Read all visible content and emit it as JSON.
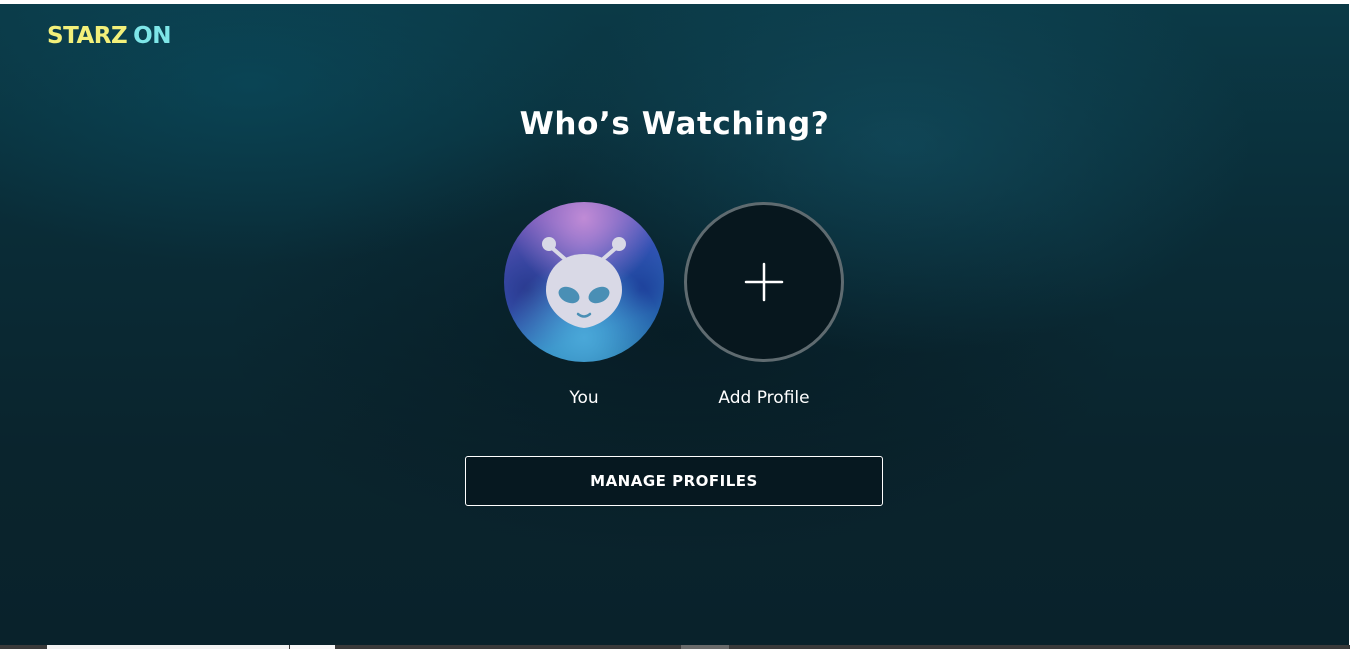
{
  "brand": {
    "logo_part1": "STARZ",
    "logo_part2": "ON",
    "logo_color_1": "#f3f07a",
    "logo_color_2": "#7ee6e8"
  },
  "header": {
    "title": "Who’s Watching?"
  },
  "profiles": [
    {
      "label": "You",
      "avatar_icon": "alien-avatar-icon"
    },
    {
      "label": "Add Profile",
      "avatar_icon": "plus-icon"
    }
  ],
  "actions": {
    "manage_profiles_label": "MANAGE PROFILES"
  },
  "colors": {
    "background": "#0a2c37",
    "text": "#ffffff",
    "add_circle_border": "#5f6b70"
  }
}
